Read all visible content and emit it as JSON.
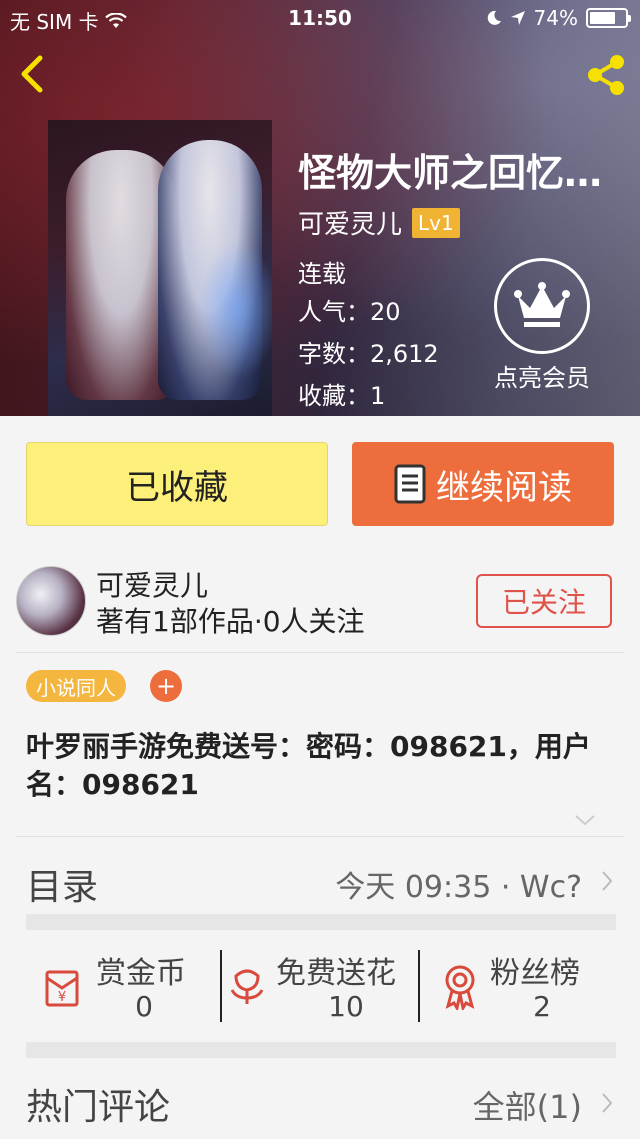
{
  "status_bar": {
    "carrier": "无 SIM 卡",
    "time": "11:50",
    "battery": "74%",
    "battery_level": 0.74
  },
  "book": {
    "title": "怪物大师之回忆…",
    "author": "可爱灵儿",
    "level": "Lv1",
    "status": "连载",
    "popularity": "人气：20",
    "word_count": "字数：2,612",
    "favorites": "收藏：1"
  },
  "vip": {
    "label": "点亮会员"
  },
  "actions": {
    "collected": "已收藏",
    "continue_reading": "继续阅读"
  },
  "author_card": {
    "name": "可爱灵儿",
    "stats": "著有1部作品·0人关注",
    "follow": "已关注"
  },
  "tags": {
    "items": [
      "小说同人"
    ],
    "add": "+"
  },
  "intro": "叶罗丽手游免费送号：密码：098621，用户名：098621",
  "catalog": {
    "title": "目录",
    "update": "今天 09:35 · Wc?"
  },
  "rewards": [
    {
      "label": "赏金币",
      "value": "0",
      "icon": "red-envelope-icon"
    },
    {
      "label": "免费送花",
      "value": "10",
      "icon": "flower-icon"
    },
    {
      "label": "粉丝榜",
      "value": "2",
      "icon": "medal-icon"
    }
  ],
  "hot_comments": {
    "title": "热门评论",
    "all": "全部(1)"
  },
  "colors": {
    "accent_orange": "#ee6d3c",
    "yellow_button": "#fdf07a",
    "follow_red": "#e0534a",
    "level_badge": "#f0b334",
    "tag_orange": "#f4b63f",
    "icon_red": "#d84a3c"
  }
}
